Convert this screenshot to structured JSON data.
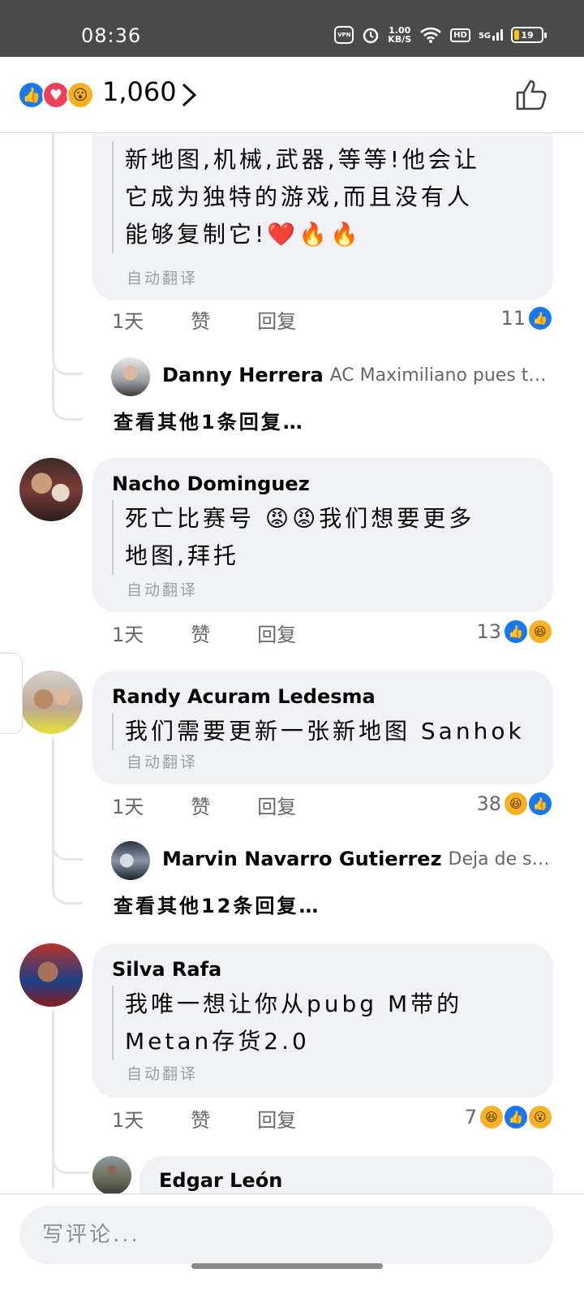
{
  "status_bar": {
    "time": "08:36",
    "vpn": "VPN",
    "speed_value": "1.00",
    "speed_unit": "KB/S",
    "hd": "HD",
    "signal": "5G",
    "battery": "19"
  },
  "header": {
    "reaction_count": "1,060",
    "reactions": [
      "like",
      "love",
      "wow"
    ]
  },
  "comments": [
    {
      "text_lines": [
        "新地图,机械,武器,等等!他会让",
        "它成为独特的游戏,而且没有人",
        "能够复制它!❤️🔥🔥"
      ],
      "translate_label": "自动翻译",
      "time": "1天",
      "like_label": "赞",
      "reply_label": "回复",
      "reaction_count": "11",
      "reply_preview": {
        "name": "Danny Herrera",
        "snippet": "AC Maximiliano pues t…"
      },
      "see_more": "查看其他1条回复…"
    },
    {
      "author": "Nacho Dominguez",
      "text_lines": [
        "死亡比赛号 😡😡我们想要更多",
        "地图,拜托"
      ],
      "translate_label": "自动翻译",
      "time": "1天",
      "like_label": "赞",
      "reply_label": "回复",
      "reaction_count": "13"
    },
    {
      "author": "Randy Acuram Ledesma",
      "text_lines": [
        "我们需要更新一张新地图 Sanhok"
      ],
      "translate_label": "自动翻译",
      "time": "1天",
      "like_label": "赞",
      "reply_label": "回复",
      "reaction_count": "38",
      "reply_preview": {
        "name": "Marvin Navarro Gutierrez",
        "snippet": "Deja de s…"
      },
      "see_more": "查看其他12条回复…"
    },
    {
      "author": "Silva Rafa",
      "text_lines": [
        "我唯一想让你从pubg M带的",
        "Metan存货2.0"
      ],
      "translate_label": "自动翻译",
      "time": "1天",
      "like_label": "赞",
      "reply_label": "回复",
      "reaction_count": "7",
      "reply_author": "Edgar León"
    }
  ],
  "composer": {
    "placeholder": "写评论..."
  },
  "colors": {
    "like_blue": "#1877f2",
    "love_red": "#f33e58",
    "wow_yellow": "#f7b125",
    "bubble_grey": "#f0f2f5"
  }
}
